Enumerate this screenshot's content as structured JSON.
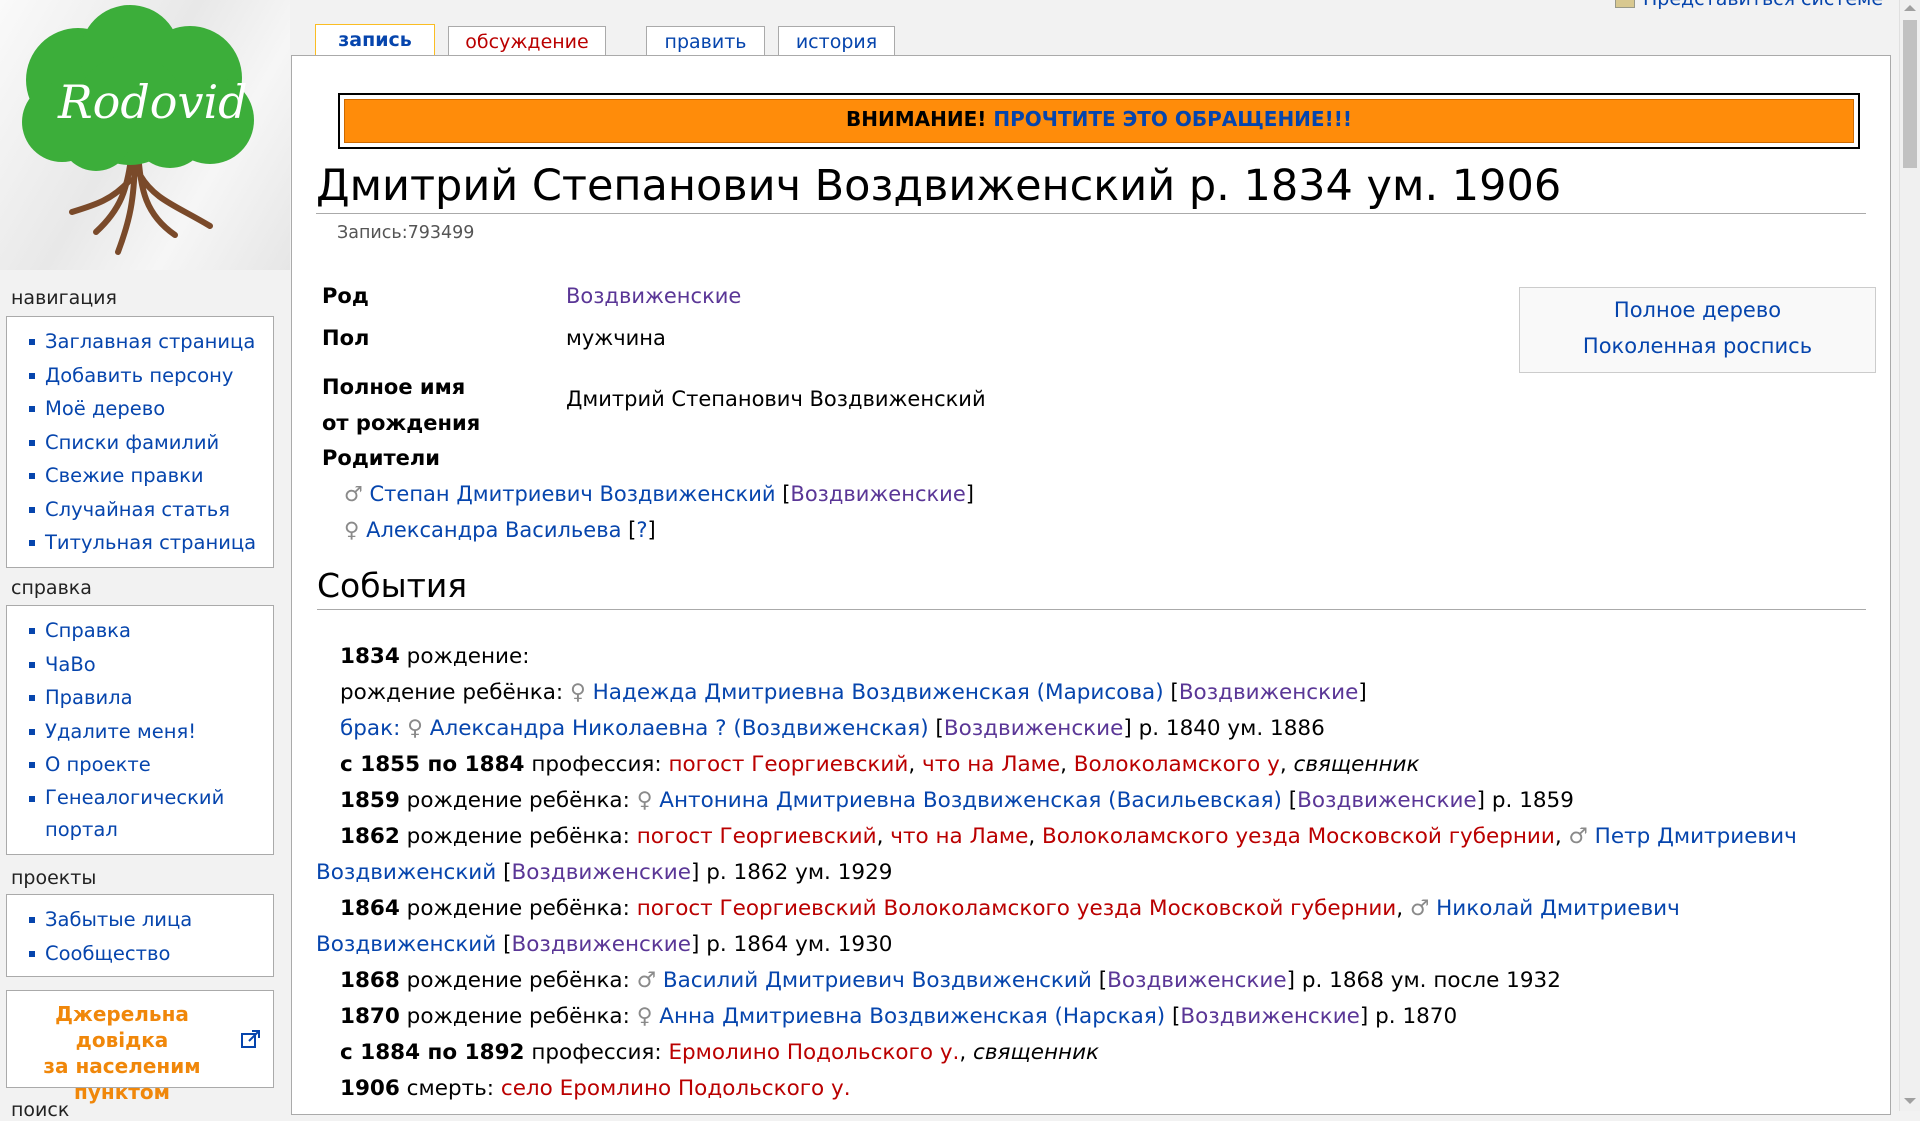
{
  "logo": {
    "text": "Rodovid"
  },
  "top_bar": {
    "user_link": "Представиться системе"
  },
  "tabs": [
    {
      "label": "запись",
      "selected": true
    },
    {
      "label": "обсуждение"
    },
    {
      "label": "править"
    },
    {
      "label": "история"
    }
  ],
  "sidebar": {
    "navigation": {
      "title": "навигация",
      "items": [
        "Заглавная страница",
        "Добавить персону",
        "Моё дерево",
        "Списки фамилий",
        "Свежие правки",
        "Случайная статья",
        "Титульная страница"
      ]
    },
    "help": {
      "title": "справка",
      "items": [
        "Справка",
        "ЧаВо",
        "Правила",
        "Удалите меня!",
        "О проекте"
      ],
      "portal_line1": "Генеалогический",
      "portal_line2": "портал"
    },
    "projects": {
      "title": "проекты",
      "items": [
        "Забытые лица",
        "Сообщество"
      ]
    },
    "ad": {
      "line1": "Джерельна довідка",
      "line2": "за населеним",
      "line3": "пунктом"
    },
    "search": {
      "title": "поиск"
    }
  },
  "notice": {
    "prefix": "ВНИМАНИЕ!",
    "link": "ПРОЧТИТЕ ЭТО ОБРАЩЕНИЕ!!!"
  },
  "page": {
    "title": "Дмитрий Степанович Воздвиженский р. 1834 ум. 1906",
    "record": "Запись:793499"
  },
  "info": {
    "clan_label": "Род",
    "clan_value": "Воздвиженские",
    "sex_label": "Пол",
    "sex_value": "мужчина",
    "fullname_label_1": "Полное имя",
    "fullname_label_2": "от рождения",
    "fullname_value": "Дмитрий Степанович Воздвиженский",
    "parents_label": "Родители",
    "father": {
      "sym": "♂",
      "name": "Степан Дмитриевич Воздвиженский",
      "clan": "Воздвиженские"
    },
    "mother": {
      "sym": "♀",
      "name": "Александра Васильева",
      "clan": "?"
    }
  },
  "tree_links": {
    "full_tree": "Полное дерево",
    "generations": "Поколенная роспись"
  },
  "events_heading": "События",
  "events": {
    "e1": {
      "year": "1834",
      "text": " рождение:"
    },
    "e2": {
      "text": "рождение ребёнка: ",
      "sym": "♀",
      "person": "Надежда Дмитриевна Воздвиженская (Марисова)",
      "clan": "Воздвиженские"
    },
    "e3": {
      "label": "брак:",
      "sym": "♀",
      "person": "Александра Николаевна ? (Воздвиженская)",
      "clan": "Воздвиженские",
      "tail": " р. 1840 ум. 1886"
    },
    "e4": {
      "year": "с 1855 по 1884",
      "text": " профессия: ",
      "place1": "погост Георгиевский",
      "place2": "что на Ламе",
      "place3": "Волоколамского у",
      "job": "священник"
    },
    "e5": {
      "year": "1859",
      "text": " рождение ребёнка: ",
      "sym": "♀",
      "person": "Антонина Дмитриевна Воздвиженская (Васильевская)",
      "clan": "Воздвиженские",
      "tail": " р. 1859"
    },
    "e6": {
      "year": "1862",
      "text": " рождение ребёнка: ",
      "place1": "погост Георгиевский",
      "place2": "что на Ламе",
      "place3": "Волоколамского уезда Московской губернии",
      "sym": "♂",
      "person": "Петр Дмитриевич Воздвиженский",
      "clan": "Воздвиженские",
      "tail": " р. 1862 ум. 1929"
    },
    "e7": {
      "year": "1864",
      "text": " рождение ребёнка: ",
      "place1": "погост Георгиевский Волоколамского уезда Московской губернии",
      "sym": "♂",
      "person": "Николай Дмитриевич Воздвиженский",
      "clan": "Воздвиженские",
      "tail": " р. 1864 ум. 1930"
    },
    "e8": {
      "year": "1868",
      "text": " рождение ребёнка: ",
      "sym": "♂",
      "person": "Василий Дмитриевич Воздвиженский",
      "clan": "Воздвиженские",
      "tail": " р. 1868 ум. после 1932"
    },
    "e9": {
      "year": "1870",
      "text": " рождение ребёнка: ",
      "sym": "♀",
      "person": "Анна Дмитриевна Воздвиженская (Нарская)",
      "clan": "Воздвиженские",
      "tail": " р. 1870"
    },
    "e10": {
      "year": "с 1884 по 1892",
      "text": " профессия: ",
      "place1": "Ермолино Подольского у.",
      "job": "священник"
    },
    "e11": {
      "year": "1906",
      "text": " смерть: ",
      "place1": "село Еромлино Подольского у."
    }
  },
  "colors": {
    "link": "#0645ad",
    "visited": "#5a3696",
    "new": "#ba0000",
    "notice": "#ff8c0a",
    "tab_selected": "#fabd23",
    "ad": "#f0870a"
  }
}
